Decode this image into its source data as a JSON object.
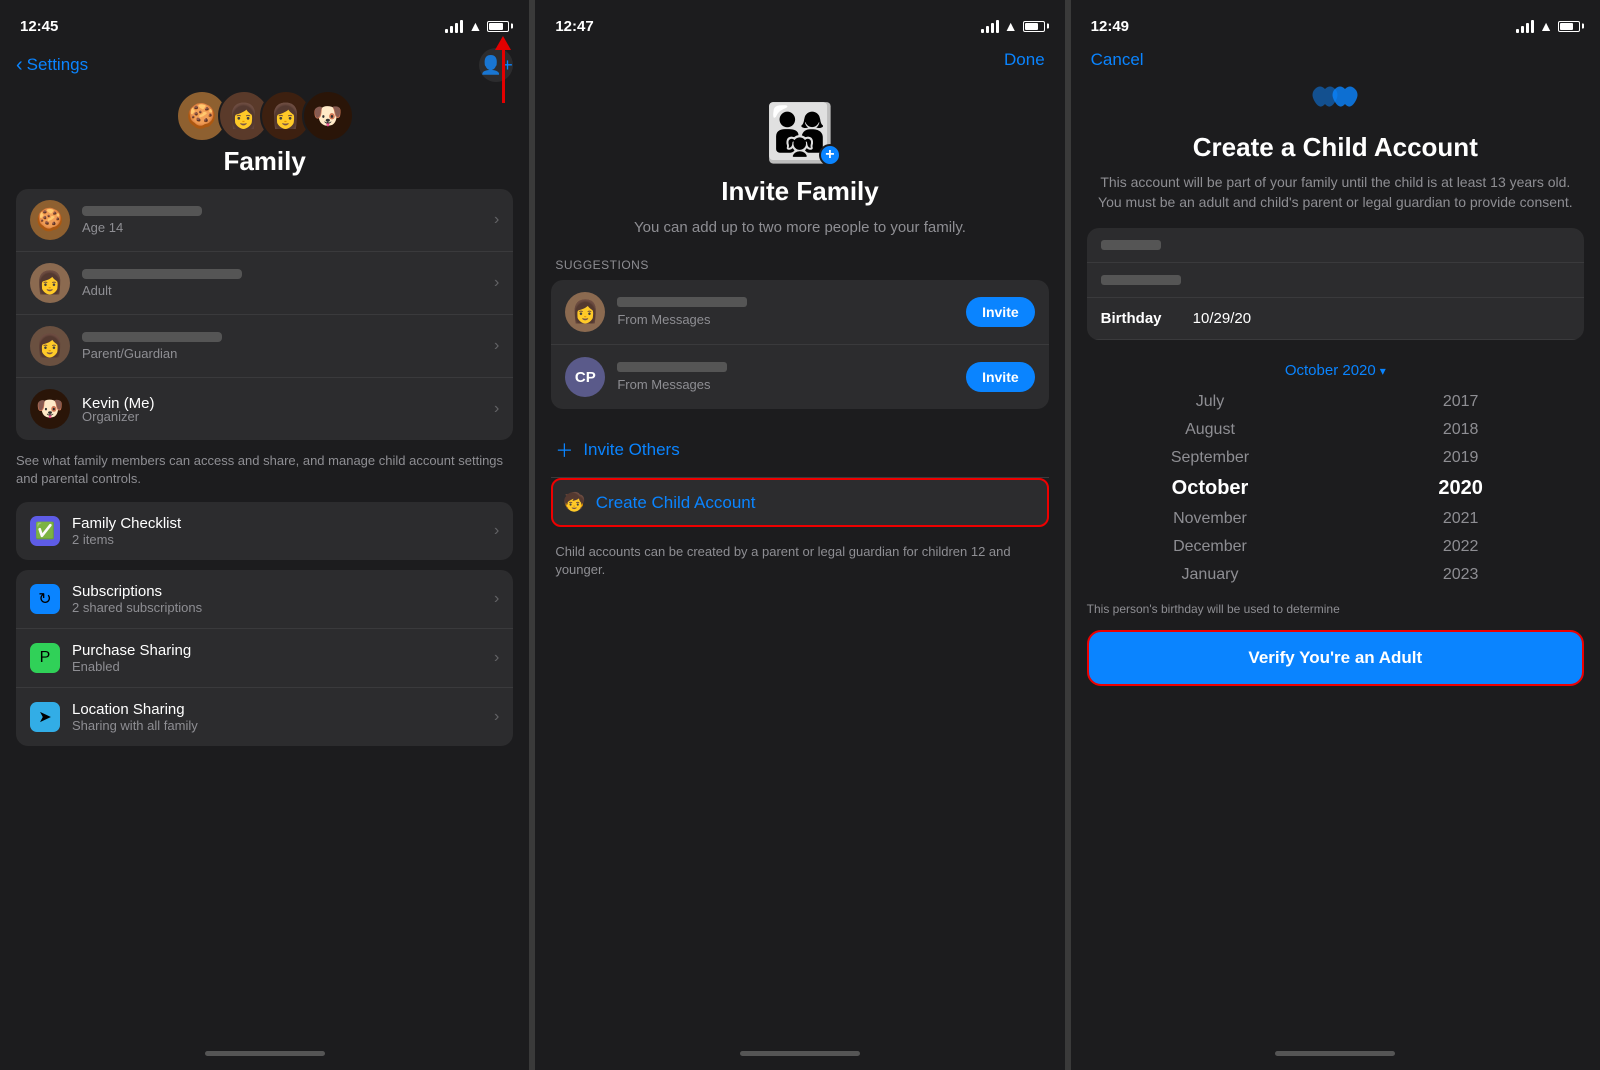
{
  "panel1": {
    "time": "12:45",
    "nav_back": "Settings",
    "title": "Family",
    "members": [
      {
        "role": "Age 14",
        "emoji": "🍪"
      },
      {
        "role": "Adult",
        "emoji": "👩"
      },
      {
        "role": "Parent/Guardian",
        "emoji": "👩"
      },
      {
        "name": "Kevin (Me)",
        "role": "Organizer",
        "emoji": "🐶"
      }
    ],
    "family_desc": "See what family members can access and share, and manage child account settings and parental controls.",
    "checklist_label": "Family Checklist",
    "checklist_sub": "2 items",
    "subscriptions_label": "Subscriptions",
    "subscriptions_sub": "2 shared subscriptions",
    "purchase_label": "Purchase Sharing",
    "purchase_sub": "Enabled",
    "location_label": "Location Sharing",
    "location_sub": "Sharing with all family"
  },
  "panel2": {
    "time": "12:47",
    "done_label": "Done",
    "title": "Invite Family",
    "desc": "You can add up to two more people to your family.",
    "suggestions_label": "SUGGESTIONS",
    "suggestions": [
      {
        "initials": "",
        "source": "From Messages",
        "type": "photo"
      },
      {
        "initials": "CP",
        "source": "From Messages",
        "type": "initials"
      }
    ],
    "invite_label": "Invite",
    "invite_others_label": "Invite Others",
    "create_child_label": "Create Child Account",
    "child_note": "Child accounts can be created by a parent or legal guardian for children 12 and younger."
  },
  "panel3": {
    "time": "12:49",
    "cancel_label": "Cancel",
    "title": "Create a Child Account",
    "desc": "This account will be part of your family until the child is at least 13 years old. You must be an adult and child's parent or legal guardian to provide consent.",
    "birthday_label": "Birthday",
    "birthday_value": "10/29/20",
    "month_header": "October 2020",
    "months": [
      "July",
      "August",
      "September",
      "October",
      "November",
      "December",
      "January"
    ],
    "years": [
      "2017",
      "2018",
      "2019",
      "2020",
      "2021",
      "2022",
      "2023"
    ],
    "birthday_note": "This person's birthday will be used to determine",
    "verify_label": "Verify You're an Adult"
  }
}
